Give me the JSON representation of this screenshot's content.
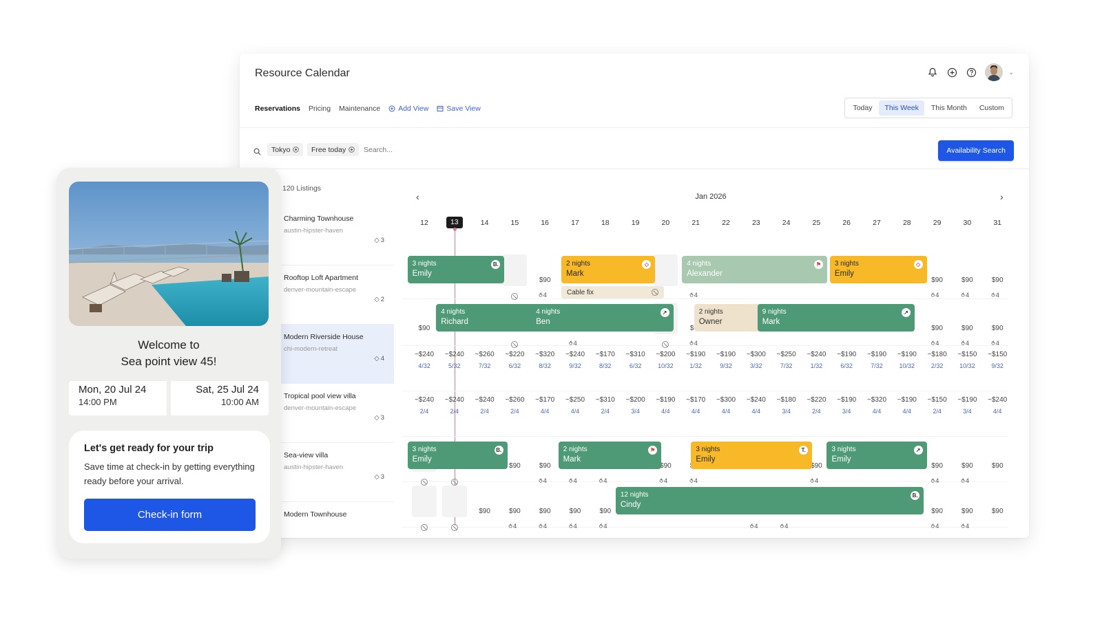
{
  "header": {
    "title": "Resource Calendar",
    "tabs": [
      "Reservations",
      "Pricing",
      "Maintenance"
    ],
    "add_view": "Add View",
    "save_view": "Save View",
    "ranges": [
      "Today",
      "This Week",
      "This Month",
      "Custom"
    ],
    "active_range": "This Week",
    "icons": [
      "bell-icon",
      "plus-circle-icon",
      "help-icon",
      "avatar"
    ]
  },
  "filters": {
    "chips": [
      "Tokyo",
      "Free today"
    ],
    "search_placeholder": "Search...",
    "availability_button": "Availability Search"
  },
  "listings": {
    "count": "120 Listings",
    "items": [
      {
        "name": "Charming Townhouse",
        "slug": "austin-hipster-haven",
        "capacity": "3"
      },
      {
        "name": "Rooftop Loft Apartment",
        "slug": "denver-mountain-escape",
        "capacity": "2"
      },
      {
        "name": "Modern Riverside House",
        "slug": "chi-modern-retreat",
        "capacity": "4"
      },
      {
        "name": "Tropical pool view villa",
        "slug": "denver-mountain-escape",
        "capacity": "3"
      },
      {
        "name": "Sea-view villa",
        "slug": "austin-hipster-haven",
        "capacity": "3"
      },
      {
        "name": "Modern Townhouse",
        "slug": "",
        "capacity": ""
      }
    ]
  },
  "calendar": {
    "month": "Jan 2026",
    "days": [
      "12",
      "13",
      "14",
      "15",
      "16",
      "17",
      "18",
      "19",
      "20",
      "21",
      "22",
      "23",
      "24",
      "25",
      "26",
      "27",
      "28",
      "29",
      "30",
      "31"
    ],
    "today": "13",
    "row2_prices": [
      "~$240",
      "~$240",
      "~$260",
      "~$220",
      "~$320",
      "~$240",
      "~$170",
      "~$310",
      "~$200",
      "~$190",
      "~$190",
      "~$300",
      "~$250",
      "~$240",
      "~$190",
      "~$190",
      "~$190",
      "~$180",
      "~$150",
      "~$150"
    ],
    "row2_occ": [
      "4/32",
      "5/32",
      "7/32",
      "6/32",
      "8/32",
      "9/32",
      "8/32",
      "6/32",
      "10/32",
      "1/32",
      "9/32",
      "3/32",
      "7/32",
      "1/32",
      "6/32",
      "7/32",
      "10/32",
      "2/32",
      "10/32",
      "9/32"
    ],
    "row3_prices": [
      "~$240",
      "~$240",
      "~$240",
      "~$260",
      "~$170",
      "~$250",
      "~$310",
      "~$200",
      "~$190",
      "~$170",
      "~$300",
      "~$240",
      "~$180",
      "~$220",
      "~$190",
      "~$320",
      "~$190",
      "~$150",
      "~$190",
      "~$240"
    ],
    "row3_occ": [
      "2/4",
      "2/4",
      "2/4",
      "2/4",
      "4/4",
      "4/4",
      "2/4",
      "3/4",
      "4/4",
      "4/4",
      "4/4",
      "4/4",
      "3/4",
      "2/4",
      "3/4",
      "4/4",
      "4/4",
      "2/4",
      "3/4",
      "4/4"
    ],
    "bookings": [
      {
        "nights": "3 nights",
        "guest": "Emily",
        "badge": "B."
      },
      {
        "nights": "2 nights",
        "guest": "Mark",
        "badge": "airbnb"
      },
      {
        "nights": "4 nights",
        "guest": "Alexander",
        "badge": "flag"
      },
      {
        "nights": "3 nights",
        "guest": "Emily",
        "badge": "airbnb"
      },
      {
        "nights": "4 nights",
        "guest": "Richard",
        "badge": "B."
      },
      {
        "nights": "4 nights",
        "guest": "Ben",
        "badge": "arrow"
      },
      {
        "nights": "2 nights",
        "guest": "Owner",
        "badge": "person"
      },
      {
        "nights": "9 nights",
        "guest": "Mark",
        "badge": "arrow"
      },
      {
        "nights": "3 nights",
        "guest": "Emily",
        "badge": "B."
      },
      {
        "nights": "2 nights",
        "guest": "Mark",
        "badge": "flag"
      },
      {
        "nights": "3 nights",
        "guest": "Emily",
        "badge": "T."
      },
      {
        "nights": "3 nights",
        "guest": "Emily",
        "badge": "arrow"
      },
      {
        "nights": "12 nights",
        "guest": "Cindy",
        "badge": "B."
      }
    ],
    "maintenance": "Cable fix",
    "price": "$90",
    "partial_price": "$9",
    "partial_price_end": "90",
    "partial_price_row1b": "30",
    "partial_zero": "0",
    "partial_dollar": "$",
    "capacity": "4"
  },
  "checkin_card": {
    "welcome_line1": "Welcome to",
    "welcome_line2": "Sea point view 45!",
    "checkin_date": "Mon, 20 Jul 24",
    "checkin_time": "14:00 PM",
    "checkout_date": "Sat, 25 Jul 24",
    "checkout_time": "10:00 AM",
    "title": "Let's get ready for your trip",
    "text": "Save time at check-in by getting everything ready before your arrival.",
    "button": "Check-in form"
  },
  "colors": {
    "primary": "#1e56e6",
    "booking_green": "#4f9a76",
    "booking_yellow": "#f7b928",
    "booking_sage": "#a8c8b0",
    "today_line": "#e07a87"
  }
}
